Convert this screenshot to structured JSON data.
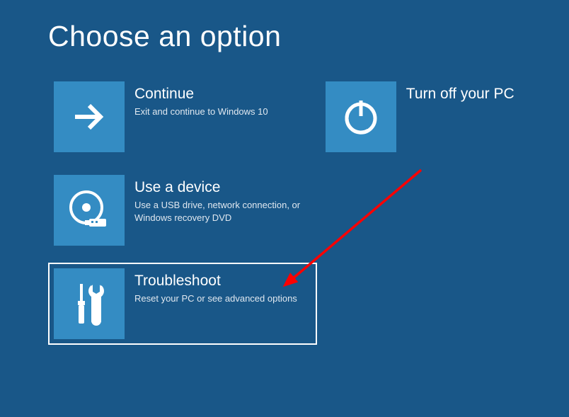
{
  "page": {
    "title": "Choose an option"
  },
  "options": {
    "continue": {
      "title": "Continue",
      "desc": "Exit and continue to Windows 10"
    },
    "turn_off": {
      "title": "Turn off your PC",
      "desc": ""
    },
    "use_device": {
      "title": "Use a device",
      "desc": "Use a USB drive, network connection, or Windows recovery DVD"
    },
    "troubleshoot": {
      "title": "Troubleshoot",
      "desc": "Reset your PC or see advanced options"
    }
  },
  "colors": {
    "background": "#195788",
    "tile": "#348cc3",
    "text": "#ffffff",
    "annotation": "#ff0000"
  }
}
